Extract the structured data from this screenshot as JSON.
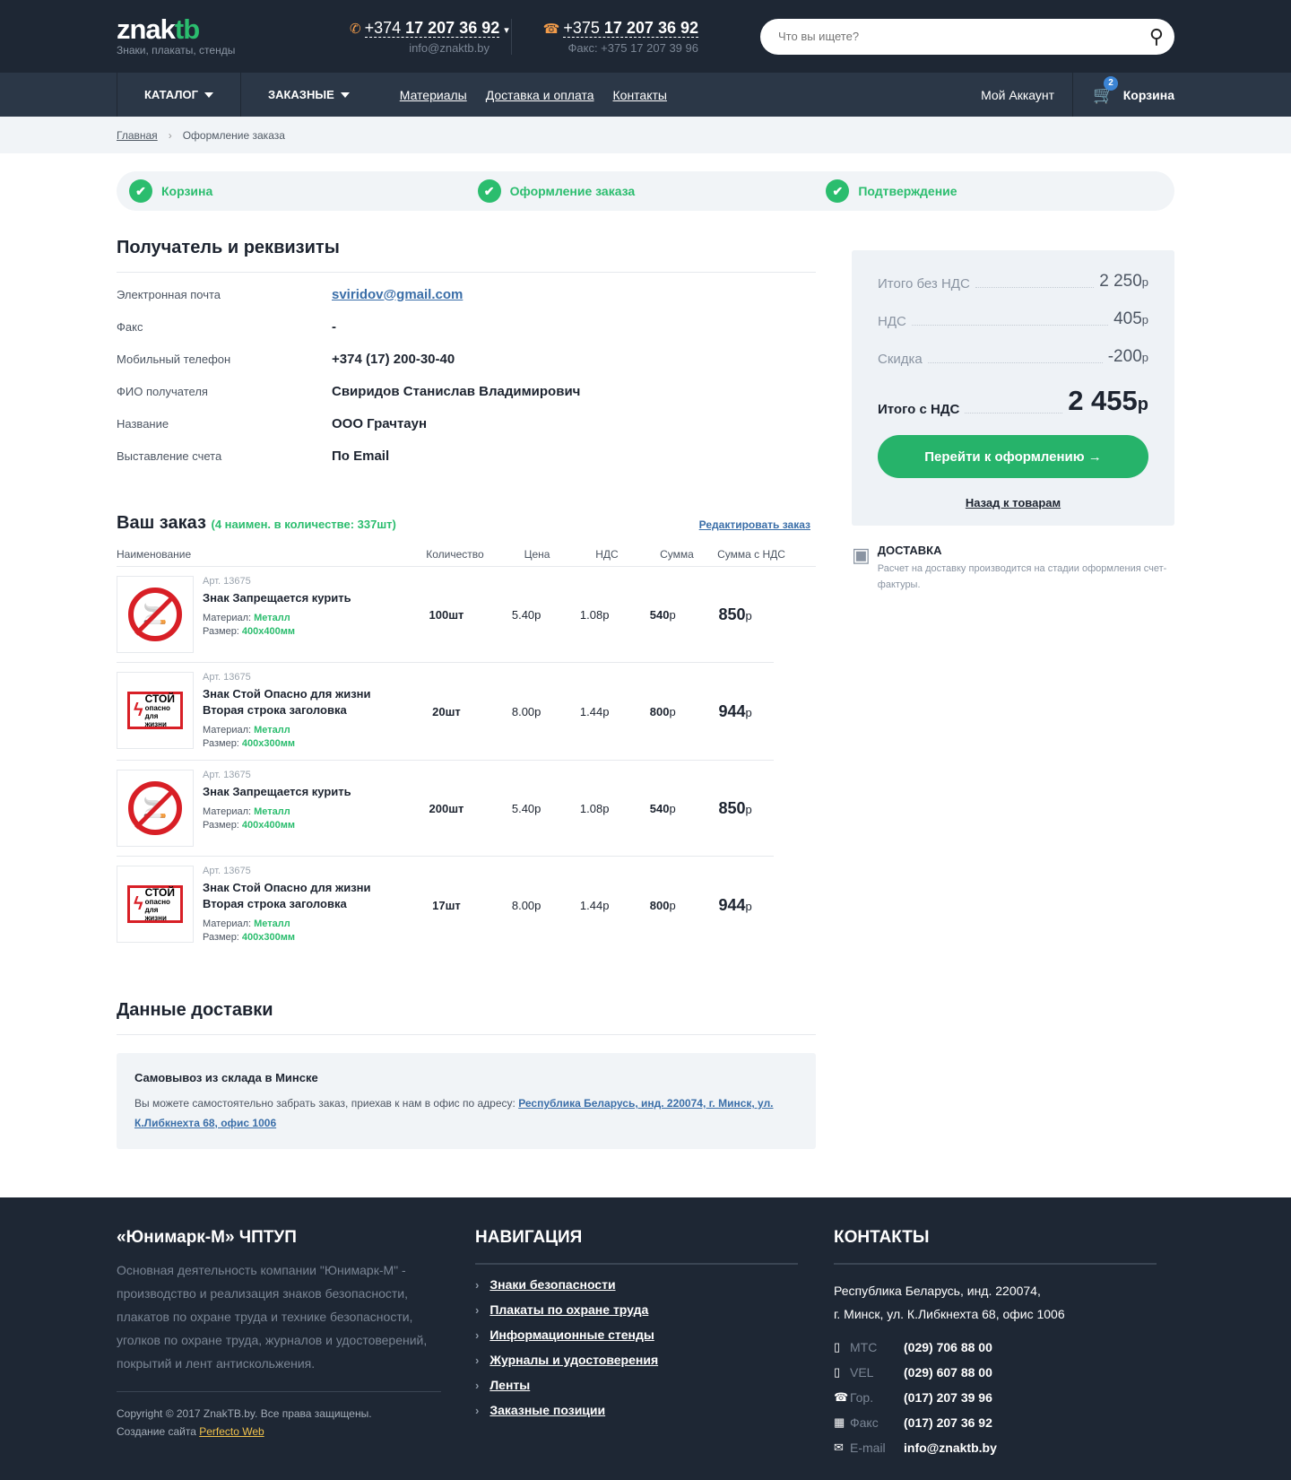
{
  "header": {
    "logo_main": "znak",
    "logo_accent": "tb",
    "logo_sub": "Знаки, плакаты, стенды",
    "phone1_prefix": "+374 ",
    "phone1_num": "17 207 36 92",
    "email": "info@znaktb.by",
    "phone2_prefix": "+375 ",
    "phone2_num": "17 207 36 92",
    "fax": "Факс: +375 17 207 39 96",
    "search_placeholder": "Что вы ищете?"
  },
  "nav": {
    "catalog": "КАТАЛОГ",
    "custom": "ЗАКАЗНЫЕ",
    "links": [
      "Материалы",
      "Доставка и оплата",
      "Контакты"
    ],
    "account": "Мой Аккаунт",
    "cart": "Корзина",
    "cart_count": "2"
  },
  "breadcrumb": {
    "home": "Главная",
    "current": "Оформление заказа"
  },
  "steps": [
    "Корзина",
    "Оформление заказа",
    "Подтверждение"
  ],
  "recipient": {
    "title": "Получатель и реквизиты",
    "rows": [
      {
        "k": "Электронная почта",
        "v": "sviridov@gmail.com"
      },
      {
        "k": "Факс",
        "v": "-"
      },
      {
        "k": "Мобильный телефон",
        "v": "+374 (17) 200-30-40"
      },
      {
        "k": "ФИО получателя",
        "v": "Свиридов Станислав Владимирович"
      },
      {
        "k": "Название",
        "v": "ООО Грачтаун"
      },
      {
        "k": "Выставление счета",
        "v": "По Email"
      }
    ]
  },
  "order": {
    "title": "Ваш заказ",
    "count": "(4 наимен. в количестве: 337шт)",
    "edit": "Редактировать заказ",
    "cols": [
      "Наименование",
      "Количество",
      "Цена",
      "НДС",
      "Сумма",
      "Сумма с НДС"
    ],
    "items": [
      {
        "art": "Арт. 13675",
        "title": "Знак Запрещается курить",
        "mat_label": "Материал: ",
        "mat": "Металл",
        "size_label": "Размер: ",
        "size": "400х400мм",
        "qty": "100шт",
        "price": "5.40р",
        "vat": "1.08р",
        "sum": "540",
        "total": "850"
      },
      {
        "art": "Арт. 13675",
        "title": "Знак Стой Опасно для жизни Вторая строка заголовка",
        "mat_label": "Материал: ",
        "mat": "Металл",
        "size_label": "Размер: ",
        "size": "400х300мм",
        "qty": "20шт",
        "price": "8.00р",
        "vat": "1.44р",
        "sum": "800",
        "total": "944"
      },
      {
        "art": "Арт. 13675",
        "title": "Знак Запрещается курить",
        "mat_label": "Материал: ",
        "mat": "Металл",
        "size_label": "Размер: ",
        "size": "400х400мм",
        "qty": "200шт",
        "price": "5.40р",
        "vat": "1.08р",
        "sum": "540",
        "total": "850"
      },
      {
        "art": "Арт. 13675",
        "title": "Знак Стой Опасно для жизни Вторая строка заголовка",
        "mat_label": "Материал: ",
        "mat": "Металл",
        "size_label": "Размер: ",
        "size": "400х300мм",
        "qty": "17шт",
        "price": "8.00р",
        "vat": "1.44р",
        "sum": "800",
        "total": "944"
      }
    ],
    "rub": "р",
    "sign_stop_big": "СТОЙ",
    "sign_stop_small": "опасно для жизни"
  },
  "delivery": {
    "title": "Данные доставки",
    "box_title": "Самовывоз из склада в Минске",
    "box_text": "Вы можете самостоятельно забрать заказ, приехав к нам в офис по адресу: ",
    "box_link": "Республика Беларусь, инд. 220074, г. Минск, ул. К.Либкнехта 68, офис 1006"
  },
  "summary": {
    "rows": [
      {
        "k": "Итого без НДС",
        "v": "2 250"
      },
      {
        "k": "НДС",
        "v": "405"
      },
      {
        "k": "Скидка",
        "v": "-200"
      }
    ],
    "total_label": "Итого с НДС",
    "total": "2 455",
    "rub": "р",
    "button": "Перейти к оформлению →",
    "back": "Назад к товарам",
    "ship_title": "ДОСТАВКА",
    "ship_text": "Расчет на доставку производится на стадии оформления счет-фактуры."
  },
  "footer": {
    "company": "«Юнимарк-М» ЧПТУП",
    "about": "Основная деятельность компании \"Юнимарк-М\" - производство и реализация знаков безопасности, плакатов по охране труда и технике безопасности, уголков по охране труда, журналов и удостоверений, покрытий и лент антискольжения.",
    "copyright": "Copyright © 2017 ZnakTB.by. Все права защищены.",
    "made_by": "Создание сайта ",
    "made_link": "Perfecto Web",
    "nav_title": "НАВИГАЦИЯ",
    "nav_items": [
      "Знаки безопасности",
      "Плакаты по охране труда",
      "Информационные стенды",
      "Журналы и удостоверения",
      "Ленты",
      "Заказные позиции"
    ],
    "contacts_title": "КОНТАКТЫ",
    "address1": "Республика Беларусь, инд. 220074,",
    "address2": "г. Минск, ул. К.Либкнехта 68, офис 1006",
    "contacts": [
      {
        "icon": "mobile-icon",
        "label": "МТС",
        "value": "(029) 706 88 00"
      },
      {
        "icon": "mobile-icon",
        "label": "VEL",
        "value": "(029) 607 88 00"
      },
      {
        "icon": "phone-icon",
        "label": "Гор.",
        "value": "(017) 207 39 96"
      },
      {
        "icon": "fax-icon",
        "label": "Факс",
        "value": "(017) 207 36 92"
      },
      {
        "icon": "mail-icon",
        "label": "E-mail",
        "value": "info@znaktb.by"
      }
    ]
  }
}
